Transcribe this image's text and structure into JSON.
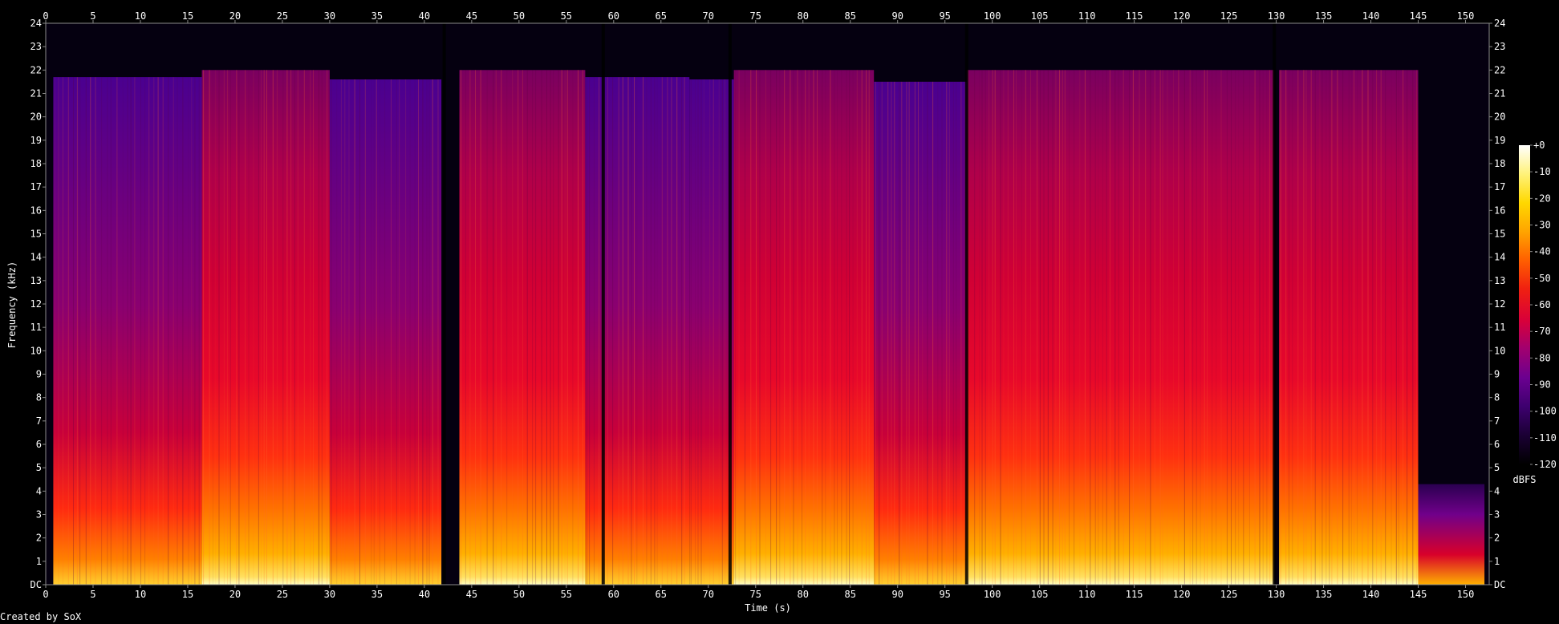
{
  "chart_data": {
    "type": "heatmap",
    "title": "",
    "xlabel": "Time (s)",
    "ylabel": "Frequency (kHz)",
    "xlim": [
      0,
      152.5
    ],
    "ylim": [
      0,
      24
    ],
    "x_ticks": [
      "0",
      "5",
      "10",
      "15",
      "20",
      "25",
      "30",
      "35",
      "40",
      "45",
      "50",
      "55",
      "60",
      "65",
      "70",
      "75",
      "80",
      "85",
      "90",
      "95",
      "100",
      "105",
      "110",
      "115",
      "120",
      "125",
      "130",
      "135",
      "140",
      "145",
      "150"
    ],
    "x_tick_values": [
      0,
      5,
      10,
      15,
      20,
      25,
      30,
      35,
      40,
      45,
      50,
      55,
      60,
      65,
      70,
      75,
      80,
      85,
      90,
      95,
      100,
      105,
      110,
      115,
      120,
      125,
      130,
      135,
      140,
      145,
      150
    ],
    "y_ticks": [
      "DC",
      "1",
      "2",
      "3",
      "4",
      "5",
      "6",
      "7",
      "8",
      "9",
      "10",
      "11",
      "12",
      "13",
      "14",
      "15",
      "16",
      "17",
      "18",
      "19",
      "20",
      "21",
      "22",
      "23",
      "24"
    ],
    "y_tick_values": [
      0,
      1,
      2,
      3,
      4,
      5,
      6,
      7,
      8,
      9,
      10,
      11,
      12,
      13,
      14,
      15,
      16,
      17,
      18,
      19,
      20,
      21,
      22,
      23,
      24
    ],
    "colorbar": {
      "label": "dBFS",
      "range": [
        -120,
        0
      ],
      "ticks": [
        "+0",
        "-10",
        "-20",
        "-30",
        "-40",
        "-50",
        "-60",
        "-70",
        "-80",
        "-90",
        "-100",
        "-110",
        "-120"
      ],
      "tick_values": [
        0,
        -10,
        -20,
        -30,
        -40,
        -50,
        -60,
        -70,
        -80,
        -90,
        -100,
        -110,
        -120
      ],
      "colors": [
        "#000000",
        "#1a0033",
        "#3d006e",
        "#6a0090",
        "#a00070",
        "#d8003a",
        "#f02010",
        "#ff6000",
        "#ffa500",
        "#ffd800",
        "#fff27a",
        "#ffffff"
      ]
    },
    "cutoff_segments_khz": [
      {
        "t": [
          0.8,
          16.5
        ],
        "cutoff": 21.7
      },
      {
        "t": [
          16.5,
          30
        ],
        "cutoff": 22.0
      },
      {
        "t": [
          30,
          41.8
        ],
        "cutoff": 21.6
      },
      {
        "t": [
          43.7,
          57
        ],
        "cutoff": 22.0
      },
      {
        "t": [
          57,
          68
        ],
        "cutoff": 21.7
      },
      {
        "t": [
          68,
          72.7
        ],
        "cutoff": 21.6
      },
      {
        "t": [
          72.7,
          87.5
        ],
        "cutoff": 22.0
      },
      {
        "t": [
          87.5,
          97.3
        ],
        "cutoff": 21.5
      },
      {
        "t": [
          97.3,
          129.8
        ],
        "cutoff": 22.0
      },
      {
        "t": [
          130.3,
          145
        ],
        "cutoff": 22.0
      },
      {
        "t": [
          145,
          152
        ],
        "cutoff": 4.3
      }
    ],
    "silent_gaps_s": [
      42.1,
      58.9,
      72.3,
      97.3,
      129.8
    ]
  },
  "footer": {
    "credit": "Created by SoX"
  }
}
